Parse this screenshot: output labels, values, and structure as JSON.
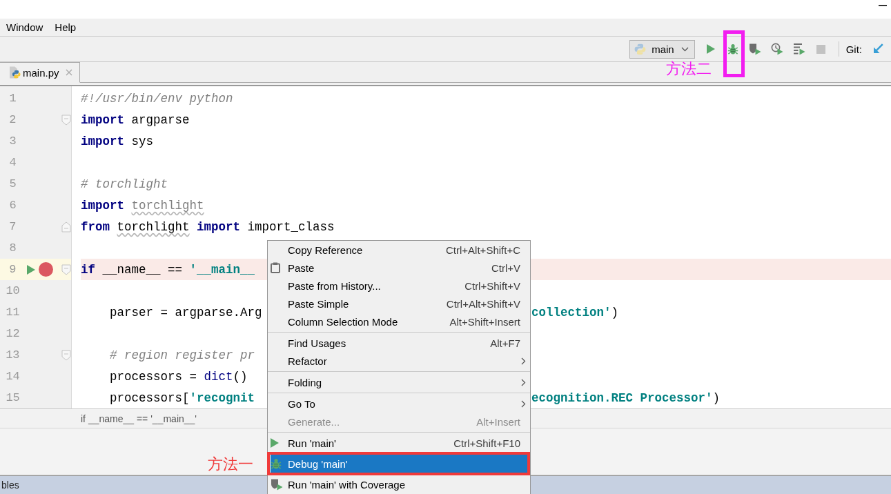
{
  "menu_bar": [
    {
      "label": "Window"
    },
    {
      "label": "Help"
    }
  ],
  "toolbar": {
    "run_config": {
      "label": "main"
    },
    "items": [
      {
        "kind": "run",
        "disabled": false
      },
      {
        "kind": "debug",
        "disabled": false,
        "annotation": {
          "text": "方法二",
          "color": "#f21ef0"
        }
      },
      {
        "kind": "coverage",
        "disabled": false
      },
      {
        "kind": "profile",
        "disabled": false
      },
      {
        "kind": "concurrency",
        "disabled": false
      },
      {
        "kind": "stop",
        "disabled": true
      },
      {
        "kind": "separator"
      },
      {
        "kind": "label",
        "text": "Git:"
      },
      {
        "kind": "update",
        "disabled": false
      }
    ]
  },
  "tabs": [
    {
      "label": "main.py",
      "selected": true
    }
  ],
  "editor": {
    "lines": [
      {
        "number": "1",
        "current": false,
        "breakpoint": false,
        "run_marker": false,
        "tokens": [
          {
            "text": "#!/usr/bin/env python",
            "kind": "comment"
          }
        ]
      },
      {
        "number": "2",
        "current": false,
        "breakpoint": false,
        "run_marker": false,
        "fold": {
          "kind": "start"
        },
        "tokens": [
          {
            "text": "import",
            "kind": "keyword"
          },
          {
            "text": " argparse",
            "kind": "plain"
          }
        ]
      },
      {
        "number": "3",
        "current": false,
        "breakpoint": false,
        "run_marker": false,
        "tokens": [
          {
            "text": "import",
            "kind": "keyword"
          },
          {
            "text": " sys",
            "kind": "plain"
          }
        ]
      },
      {
        "number": "4",
        "current": false,
        "breakpoint": false,
        "run_marker": false
      },
      {
        "number": "5",
        "current": false,
        "breakpoint": false,
        "run_marker": false,
        "tokens": [
          {
            "text": "# torchlight",
            "kind": "comment"
          }
        ]
      },
      {
        "number": "6",
        "current": false,
        "breakpoint": false,
        "run_marker": false,
        "tokens": [
          {
            "text": "import ",
            "kind": "keyword"
          },
          {
            "text": "torchlight",
            "kind": "unused"
          }
        ]
      },
      {
        "number": "7",
        "current": false,
        "breakpoint": false,
        "run_marker": false,
        "fold": {
          "kind": "end"
        },
        "tokens": [
          {
            "text": "from ",
            "kind": "keyword"
          },
          {
            "text": "torchlight",
            "kind": "typo"
          },
          {
            "text": " import ",
            "kind": "keyword"
          },
          {
            "text": "import_class",
            "kind": "plain"
          }
        ]
      },
      {
        "number": "8",
        "current": false,
        "breakpoint": false,
        "run_marker": false
      },
      {
        "number": "9",
        "current": true,
        "breakpoint": true,
        "run_marker": true,
        "fold": {
          "kind": "start"
        },
        "tokens": [
          {
            "text": "if",
            "kind": "keyword"
          },
          {
            "text": " __name__ == ",
            "kind": "plain"
          },
          {
            "text": "'__main__",
            "kind": "string"
          }
        ]
      },
      {
        "number": "10",
        "current": false,
        "breakpoint": false,
        "run_marker": false
      },
      {
        "number": "11",
        "current": false,
        "breakpoint": false,
        "run_marker": false,
        "tokens": [
          {
            "text": "    parser = argparse.Arg",
            "kind": "plain"
          }
        ],
        "tokens_right": [
          {
            "text": "collection'",
            "kind": "string"
          },
          {
            "text": ")",
            "kind": "plain"
          }
        ]
      },
      {
        "number": "12",
        "current": false,
        "breakpoint": false,
        "run_marker": false
      },
      {
        "number": "13",
        "current": false,
        "breakpoint": false,
        "run_marker": false,
        "fold": {
          "kind": "start"
        },
        "tokens": [
          {
            "text": "    # region register pr",
            "kind": "comment"
          }
        ]
      },
      {
        "number": "14",
        "current": false,
        "breakpoint": false,
        "run_marker": false,
        "tokens": [
          {
            "text": "    processors = ",
            "kind": "plain"
          },
          {
            "text": "dict",
            "kind": "builtin"
          },
          {
            "text": "()",
            "kind": "plain"
          }
        ]
      },
      {
        "number": "15",
        "current": false,
        "breakpoint": false,
        "run_marker": false,
        "tokens": [
          {
            "text": "    processors[",
            "kind": "plain"
          },
          {
            "text": "'recognit",
            "kind": "string"
          }
        ],
        "tokens_right": [
          {
            "text": "ecognition.REC Processor'",
            "kind": "string"
          },
          {
            "text": ")",
            "kind": "plain"
          }
        ]
      }
    ]
  },
  "breadcrumb": "if __name__ == '__main__'",
  "tool_window": {
    "title": "bles"
  },
  "context_menu": {
    "items": [
      {
        "kind": "plain",
        "label": "Copy Reference",
        "shortcut": "Ctrl+Alt+Shift+C",
        "submenu": false,
        "disabled": false,
        "selected": false
      },
      {
        "kind": "clipboard",
        "label": "Paste",
        "shortcut": "Ctrl+V",
        "submenu": false,
        "disabled": false,
        "selected": false
      },
      {
        "kind": "plain",
        "label": "Paste from History...",
        "shortcut": "Ctrl+Shift+V",
        "submenu": false,
        "disabled": false,
        "selected": false
      },
      {
        "kind": "plain",
        "label": "Paste Simple",
        "shortcut": "Ctrl+Alt+Shift+V",
        "submenu": false,
        "disabled": false,
        "selected": false
      },
      {
        "kind": "plain",
        "label": "Column Selection Mode",
        "shortcut": "Alt+Shift+Insert",
        "submenu": false,
        "disabled": false,
        "selected": false
      },
      {
        "kind": "separator"
      },
      {
        "kind": "plain",
        "label": "Find Usages",
        "shortcut": "Alt+F7",
        "submenu": false,
        "disabled": false,
        "selected": false
      },
      {
        "kind": "plain",
        "label": "Refactor",
        "submenu": true,
        "disabled": false,
        "selected": false
      },
      {
        "kind": "separator"
      },
      {
        "kind": "plain",
        "label": "Folding",
        "submenu": true,
        "disabled": false,
        "selected": false
      },
      {
        "kind": "separator"
      },
      {
        "kind": "plain",
        "label": "Go To",
        "submenu": true,
        "disabled": false,
        "selected": false
      },
      {
        "kind": "plain",
        "label": "Generate...",
        "shortcut": "Alt+Insert",
        "submenu": false,
        "disabled": true,
        "selected": false
      },
      {
        "kind": "separator"
      },
      {
        "kind": "run",
        "label": "Run 'main'",
        "shortcut": "Ctrl+Shift+F10",
        "submenu": false,
        "disabled": false,
        "selected": false
      },
      {
        "kind": "debug",
        "label": "Debug 'main'",
        "submenu": false,
        "disabled": false,
        "selected": true,
        "annotation": {
          "text": "方法一",
          "color": "#f03a3a"
        }
      },
      {
        "kind": "coverage",
        "label": "Run 'main' with Coverage",
        "submenu": false,
        "disabled": false,
        "selected": false
      }
    ]
  }
}
